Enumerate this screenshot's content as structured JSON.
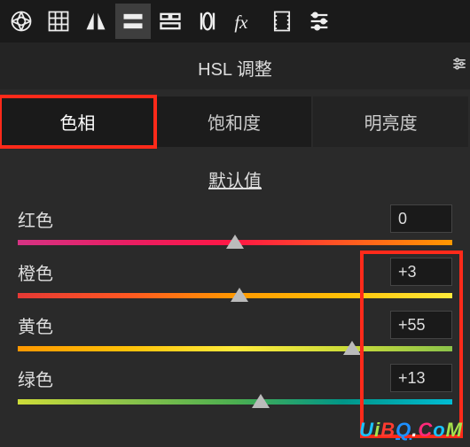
{
  "panel_title": "HSL 调整",
  "tabs": {
    "hue": "色相",
    "saturation": "饱和度",
    "lightness": "明亮度"
  },
  "default_label": "默认值",
  "sliders": {
    "red": {
      "label": "红色",
      "value": "0",
      "pos": 50
    },
    "orange": {
      "label": "橙色",
      "value": "+3",
      "pos": 51
    },
    "yellow": {
      "label": "黄色",
      "value": "+55",
      "pos": 77
    },
    "green": {
      "label": "绿色",
      "value": "+13",
      "pos": 56
    }
  },
  "toolbar_icons": [
    "aperture-icon",
    "grid-icon",
    "mirror-icon",
    "hsl-icon",
    "split-icon",
    "lens-icon",
    "fx-icon",
    "film-icon",
    "sliders-icon"
  ],
  "watermark": "UiBQ.CoM"
}
